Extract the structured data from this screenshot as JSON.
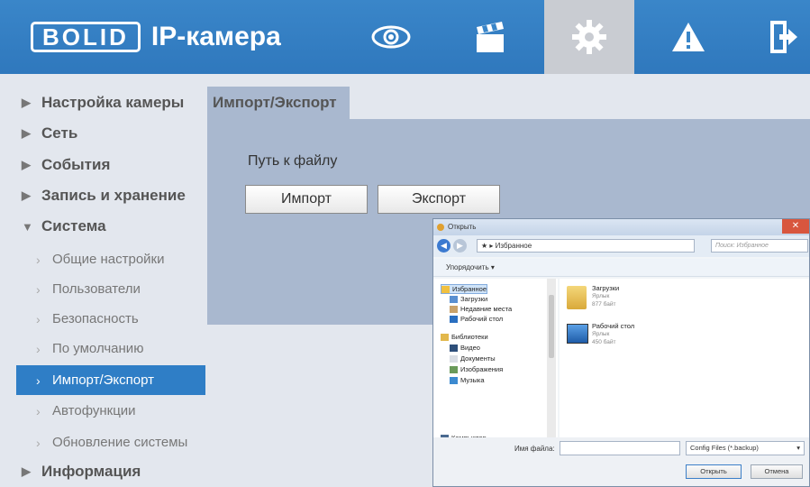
{
  "header": {
    "logo_text": "BOLID",
    "title": "IP-камера",
    "icons": [
      "eye-icon",
      "clapperboard-icon",
      "gear-icon",
      "warning-icon",
      "logout-icon"
    ],
    "active_icon": "gear-icon"
  },
  "sidebar": {
    "items": [
      {
        "label": "Настройка камеры",
        "arrow": "▶"
      },
      {
        "label": "Сеть",
        "arrow": "▶"
      },
      {
        "label": "События",
        "arrow": "▶"
      },
      {
        "label": "Запись и хранение",
        "arrow": "▶"
      },
      {
        "label": "Система",
        "arrow": "▼"
      },
      {
        "label": "Информация",
        "arrow": "▶"
      }
    ],
    "subitems": [
      {
        "label": "Общие настройки"
      },
      {
        "label": "Пользователи"
      },
      {
        "label": "Безопасность"
      },
      {
        "label": "По умолчанию"
      },
      {
        "label": "Импорт/Экспорт"
      },
      {
        "label": "Автофункции"
      },
      {
        "label": "Обновление системы"
      }
    ],
    "active_subitem": "Импорт/Экспорт"
  },
  "content": {
    "tab_label": "Импорт/Экспорт",
    "path_label": "Путь к файлу",
    "import_button": "Импорт",
    "export_button": "Экспорт"
  },
  "dialog": {
    "title": "Открыть",
    "address": "★ ▸ Избранное",
    "search_placeholder": "Поиск: Избранное",
    "organize": "Упорядочить ▾",
    "tree": [
      {
        "label": "Избранное"
      },
      {
        "label": "Загрузки"
      },
      {
        "label": "Недавние места"
      },
      {
        "label": "Рабочий стол"
      },
      {
        "label": "Библиотеки"
      },
      {
        "label": "Видео"
      },
      {
        "label": "Документы"
      },
      {
        "label": "Изображения"
      },
      {
        "label": "Музыка"
      },
      {
        "label": "Компьютер"
      }
    ],
    "files": [
      {
        "name": "Загрузки",
        "type": "Ярлык",
        "size": "877 байт"
      },
      {
        "name": "Рабочий стол",
        "type": "Ярлык",
        "size": "450 байт"
      }
    ],
    "filename_label": "Имя файла:",
    "filename_value": "",
    "filetype": "Config Files (*.backup)",
    "open_button": "Открыть",
    "cancel_button": "Отмена"
  },
  "colors": {
    "header": "#3480c4",
    "active_nav": "#2f7ec6",
    "panel": "#a9b8cf",
    "page": "#e3e7ee"
  }
}
